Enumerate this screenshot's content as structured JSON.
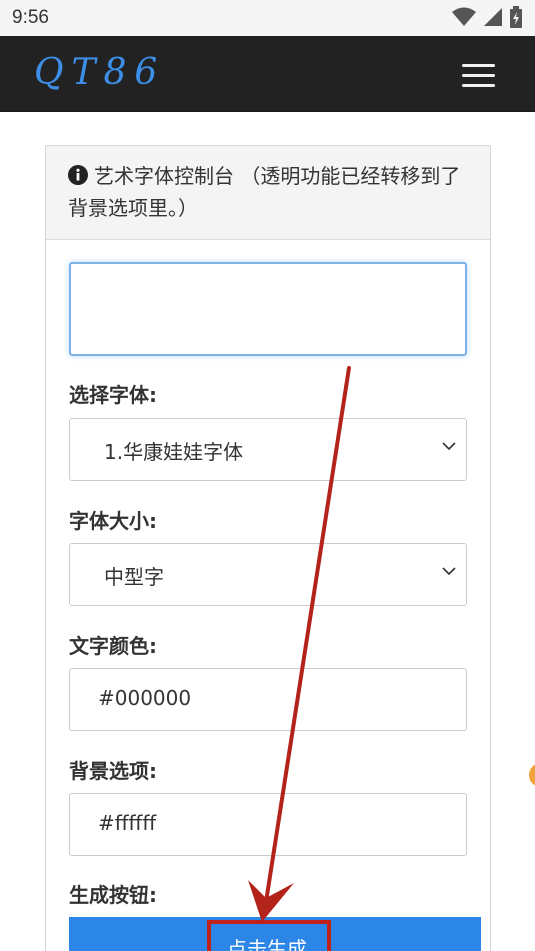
{
  "statusbar": {
    "time": "9:56",
    "icons": [
      "wifi-icon",
      "cell-signal-icon",
      "battery-icon"
    ]
  },
  "navbar": {
    "brand": "QT86",
    "menu_icon": "hamburger-menu-icon"
  },
  "panel": {
    "heading": "艺术字体控制台 （透明功能已经转移到了背景选项里。）",
    "heading_icon": "info-circle-icon"
  },
  "form": {
    "text_input": {
      "value": "",
      "placeholder": ""
    },
    "font": {
      "label": "选择字体:",
      "value": "1.华康娃娃字体"
    },
    "size": {
      "label": "字体大小:",
      "value": "中型字"
    },
    "text_color": {
      "label": "文字颜色:",
      "value": "#000000"
    },
    "background": {
      "label": "背景选项:",
      "value": "#ffffff"
    },
    "button": {
      "label": "生成按钮:",
      "text": "点击生成"
    }
  },
  "colors": {
    "navbar_bg": "#222222",
    "brand": "#3d8ee6",
    "button": "#2c86e8",
    "annotation": "#c0221b"
  }
}
